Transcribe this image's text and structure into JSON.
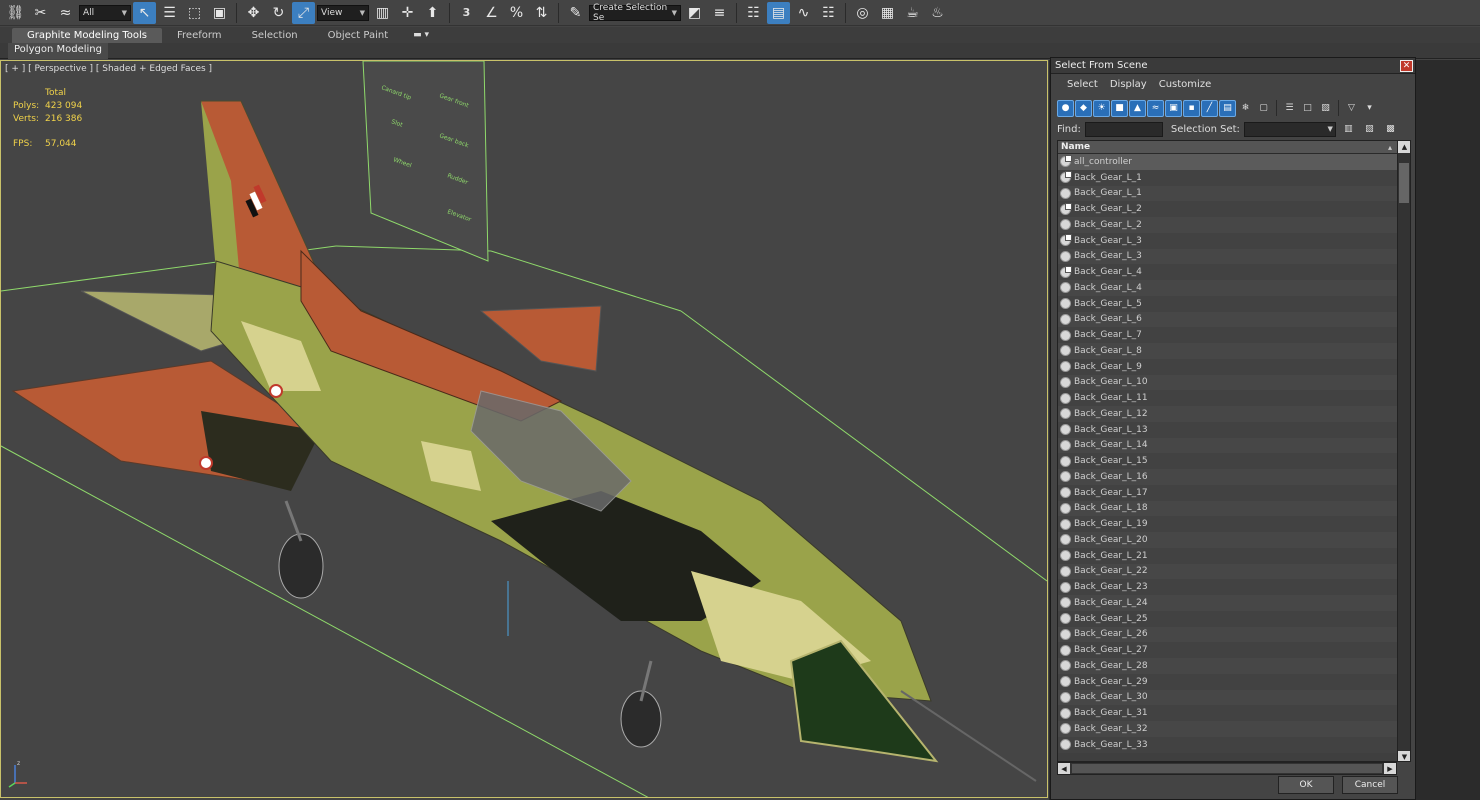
{
  "toolbar": {
    "filter_value": "All",
    "view_value": "View",
    "snap_3": "3",
    "selection_set_value": "Create Selection Se"
  },
  "ribbon": {
    "tabs": [
      "Graphite Modeling Tools",
      "Freeform",
      "Selection",
      "Object Paint"
    ],
    "sub_panel": "Polygon Modeling"
  },
  "viewport": {
    "label": "[ + ] [ Perspective ] [ Shaded + Edged Faces ]",
    "stats": {
      "total_label": "Total",
      "polys_label": "Polys:",
      "polys_value": "423 094",
      "verts_label": "Verts:",
      "verts_value": "216 386",
      "fps_label": "FPS:",
      "fps_value": "57,044"
    },
    "colors": {
      "grid": "#8fd96b",
      "viewport_border": "#c9c26a",
      "panel_text": "#f0d24a"
    }
  },
  "dialog": {
    "title": "Select From Scene",
    "menu": [
      "Select",
      "Display",
      "Customize"
    ],
    "find_label": "Find:",
    "find_value": "",
    "selection_set_label": "Selection Set:",
    "column_name": "Name",
    "rows": [
      "all_controller",
      "Back_Gear_L_1",
      "Back_Gear_L_1",
      "Back_Gear_L_2",
      "Back_Gear_L_2",
      "Back_Gear_L_3",
      "Back_Gear_L_3",
      "Back_Gear_L_4",
      "Back_Gear_L_4",
      "Back_Gear_L_5",
      "Back_Gear_L_6",
      "Back_Gear_L_7",
      "Back_Gear_L_8",
      "Back_Gear_L_9",
      "Back_Gear_L_10",
      "Back_Gear_L_11",
      "Back_Gear_L_12",
      "Back_Gear_L_13",
      "Back_Gear_L_14",
      "Back_Gear_L_15",
      "Back_Gear_L_16",
      "Back_Gear_L_17",
      "Back_Gear_L_18",
      "Back_Gear_L_19",
      "Back_Gear_L_20",
      "Back_Gear_L_21",
      "Back_Gear_L_22",
      "Back_Gear_L_23",
      "Back_Gear_L_24",
      "Back_Gear_L_25",
      "Back_Gear_L_26",
      "Back_Gear_L_27",
      "Back_Gear_L_28",
      "Back_Gear_L_29",
      "Back_Gear_L_30",
      "Back_Gear_L_31",
      "Back_Gear_L_32",
      "Back_Gear_L_33"
    ],
    "ok_label": "OK",
    "cancel_label": "Cancel"
  }
}
